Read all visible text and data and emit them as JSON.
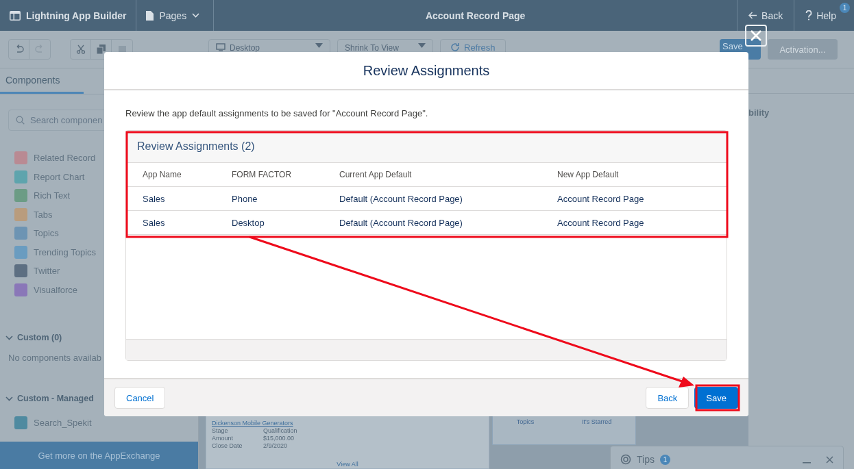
{
  "top_bar": {
    "app_title": "Lightning App Builder",
    "pages_menu": "Pages",
    "page_title": "Account Record Page",
    "back": "Back",
    "help": "Help",
    "help_badge": "1"
  },
  "toolbar": {
    "device_select": "Desktop",
    "view_select": "Shrink To View",
    "refresh": "Refresh",
    "save": "Save",
    "activation": {
      "label": "Activation...",
      "disabled": true
    }
  },
  "sidebar": {
    "tab": {
      "label": "Components",
      "selected": true
    },
    "search_placeholder": "Search componen",
    "items": [
      {
        "label": "Related Record",
        "color": "#b98a93"
      },
      {
        "label": "Report Chart",
        "color": "#5ea4ad"
      },
      {
        "label": "Rich Text",
        "color": "#6c9c85"
      },
      {
        "label": "Tabs",
        "color": "#b99c7d"
      },
      {
        "label": "Topics",
        "color": "#6d94b3"
      },
      {
        "label": "Trending Topics",
        "color": "#6a9cc0"
      },
      {
        "label": "Twitter",
        "color": "#5d6f82"
      },
      {
        "label": "Visualforce",
        "color": "#8a77b8"
      }
    ],
    "custom": {
      "title": "Custom (0)",
      "expanded": true,
      "empty_text": "No components availab"
    },
    "managed": {
      "title": "Custom - Managed",
      "expanded": true,
      "items": [
        {
          "label": "Search_Spekit",
          "color": "#4f8aa0"
        }
      ]
    },
    "footer": "Get more on the AppExchange"
  },
  "canvas": {
    "record_card": {
      "title": "Dickenson Mobile Generators",
      "fields": [
        {
          "label": "Stage",
          "value": "Qualification"
        },
        {
          "label": "Amount",
          "value": "$15,000.00"
        },
        {
          "label": "Close Date",
          "value": "2/9/2020"
        }
      ],
      "link": "View All"
    },
    "side_card": {
      "tabs": [
        "Topics",
        "It's Starred"
      ]
    }
  },
  "right_panel": {
    "heading": "bility"
  },
  "tips": {
    "label": "Tips",
    "badge": "1"
  },
  "modal": {
    "title": "Review Assignments",
    "description": "Review the app default assignments to be saved for \"Account Record Page\".",
    "table": {
      "title": "Review Assignments (2)",
      "columns": [
        "App Name",
        "FORM FACTOR",
        "Current App Default",
        "New App Default"
      ],
      "rows": [
        [
          "Sales",
          "Phone",
          "Default (Account Record Page)",
          "Account Record Page"
        ],
        [
          "Sales",
          "Desktop",
          "Default (Account Record Page)",
          "Account Record Page"
        ]
      ]
    },
    "buttons": {
      "cancel": "Cancel",
      "back": "Back",
      "save": "Save"
    }
  }
}
